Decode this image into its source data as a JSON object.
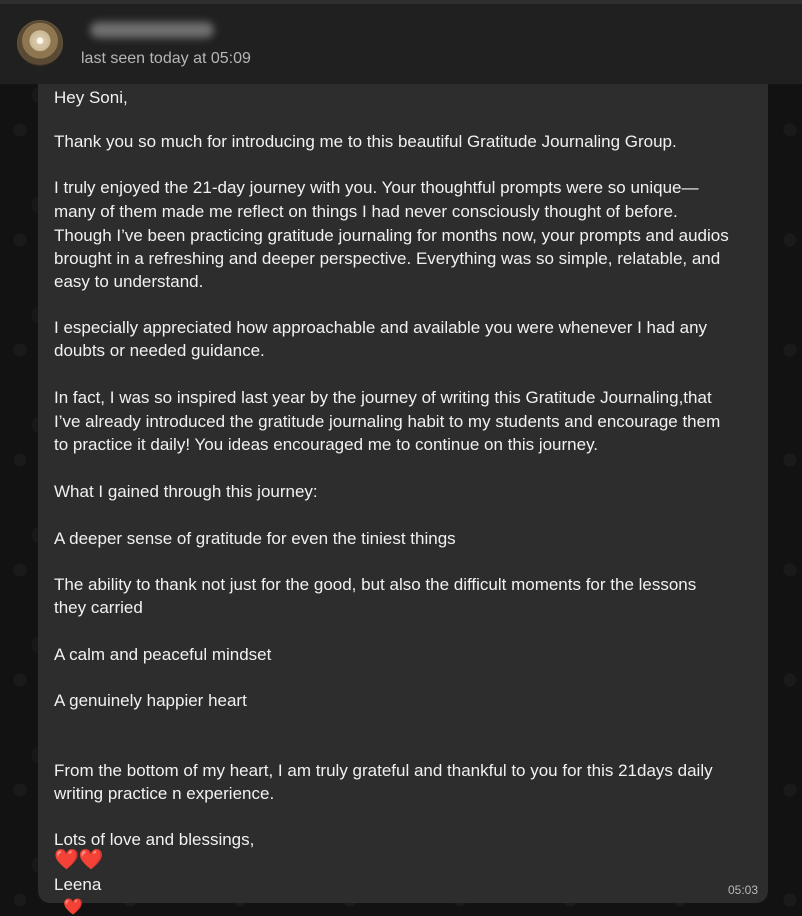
{
  "header": {
    "status": "last seen today at 05:09"
  },
  "message": {
    "lines": [
      "Hey Soni,",
      "Thank you so much for introducing me to this beautiful Gratitude Journaling Group.",
      "I truly enjoyed the 21-day journey with you. Your thoughtful prompts were so unique—",
      "many of them made me reflect on things I had never consciously thought of before.",
      "Though I’ve been practicing gratitude journaling for months now, your prompts and audios",
      "brought in a refreshing and deeper perspective. Everything was so simple, relatable, and",
      "easy to understand.",
      "I especially appreciated how approachable and available you were whenever I had any",
      "doubts or needed guidance.",
      "In fact, I was so inspired last year by the journey of writing this Gratitude Journaling,that",
      "I’ve already introduced the gratitude journaling habit to my students and encourage them",
      "to practice it daily! You ideas encouraged me to  continue on this journey.",
      "What I gained through this journey:",
      "A deeper sense of gratitude for even the tiniest things",
      "The ability to thank not just for the good, but also the difficult moments for the lessons",
      "they carried",
      "A calm and peaceful mindset",
      "A genuinely happier heart",
      "From the bottom of my heart, I am truly grateful and thankful to you for this 21days daily",
      "writing practice n experience.",
      "Lots of love and blessings,",
      "❤️❤️",
      "Leena"
    ],
    "timestamp": "05:03",
    "reaction": "❤️"
  }
}
